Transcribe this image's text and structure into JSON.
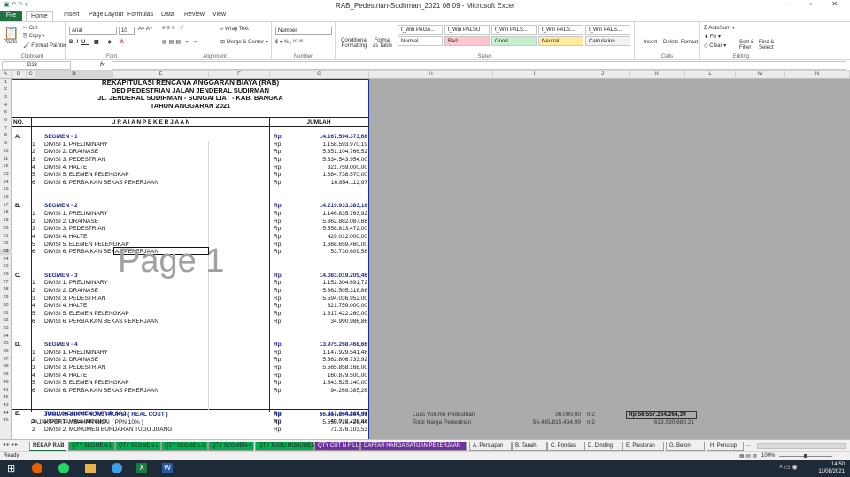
{
  "window": {
    "title": "RAB_Pedestrian-Sudirman_2021 08 09  -  Microsoft Excel",
    "controls": "— ▫ ✕"
  },
  "ribbon_tabs": [
    "File",
    "Home",
    "Insert",
    "Page Layout",
    "Formulas",
    "Data",
    "Review",
    "View"
  ],
  "ribbon": {
    "clipboard": {
      "paste": "Paste",
      "cut": "Cut",
      "copy": "Copy",
      "format_painter": "Format Painter",
      "label": "Clipboard"
    },
    "font": {
      "name": "Arial",
      "size": "10",
      "label": "Font"
    },
    "alignment": {
      "wrap": "Wrap Text",
      "merge": "Merge & Center",
      "label": "Alignment"
    },
    "number": {
      "format": "Number",
      "label": "Number"
    },
    "styles": {
      "cond": "Conditional Formatting",
      "table": "Format as Table",
      "label": "Styles",
      "items": [
        {
          "t": "t_Win PAGA...",
          "bg": "#ffffff"
        },
        {
          "t": "t_Win PALSU",
          "bg": "#ffffff"
        },
        {
          "t": "t_Win PALS...",
          "bg": "#ffffff"
        },
        {
          "t": "t_Win PALS...",
          "bg": "#ffffff"
        },
        {
          "t": "t_Win PALS...",
          "bg": "#ffffff"
        },
        {
          "t": "Normal",
          "bg": "#ffffff"
        },
        {
          "t": "Bad",
          "bg": "#ffc7ce"
        },
        {
          "t": "Good",
          "bg": "#c6efce"
        },
        {
          "t": "Neutral",
          "bg": "#ffeb9c"
        },
        {
          "t": "Calculation",
          "bg": "#f2f2f2"
        }
      ]
    },
    "cells": {
      "insert": "Insert",
      "delete": "Delete",
      "format": "Format",
      "label": "Cells"
    },
    "editing": {
      "autosum": "AutoSum",
      "fill": "Fill",
      "clear": "Clear",
      "sort": "Sort & Filter",
      "find": "Find & Select",
      "label": "Editing"
    }
  },
  "name_box": "D23",
  "fx": "fx",
  "columns": [
    "A",
    "B",
    "C",
    "D",
    "E",
    "F",
    "G",
    "H",
    "I",
    "J",
    "K",
    "L",
    "M",
    "N"
  ],
  "rows": [
    "1",
    "2",
    "3",
    "4",
    "5",
    "6",
    "7",
    "8",
    "9",
    "10",
    "11",
    "12",
    "13",
    "14",
    "15",
    "16",
    "17",
    "18",
    "19",
    "20",
    "21",
    "22",
    "23",
    "24",
    "25",
    "26",
    "27",
    "28",
    "29",
    "30",
    "31",
    "32",
    "33",
    "34",
    "35",
    "36",
    "37",
    "38",
    "39",
    "40",
    "41",
    "42",
    "43",
    "44",
    "45"
  ],
  "header": {
    "title": "REKAPITULASI RENCANA ANGGARAN BIAYA (RAB)",
    "line2": "DED PEDESTRIAN JALAN JENDERAL SUDIRMAN",
    "line3": "JL. JENDERAL SUDIRMAN - SUNGAI LIAT - KAB. BANGKA",
    "line4": "TAHUN ANGGARAN 2021"
  },
  "table_headers": {
    "no": "NO.",
    "uraian": "U R A I A N   P E K E R J A A N",
    "jumlah": "JUMLAH"
  },
  "sections": [
    {
      "no": "A.",
      "title": "SEGMEN - 1",
      "rp": "Rp",
      "total": "14.167.594.373,68",
      "items": [
        [
          "1",
          "DIVISI 1. PRELIMINARY",
          "1.158.593.970,19"
        ],
        [
          "2",
          "DIVISI 2. DRAINASE",
          "5.351.104.766,52"
        ],
        [
          "3",
          "DIVISI 3. PEDESTRIAN",
          "5.634.543.954,00"
        ],
        [
          "4",
          "DIVISI 4. HALTE",
          "321.759.000,00"
        ],
        [
          "5",
          "DIVISI 5. ELEMEN PELENGKAP",
          "1.684.738.570,00"
        ],
        [
          "6",
          "DIVISI 6. PERBAIKAN BEKAS PEKERJAAN",
          "16.854.112,97"
        ]
      ]
    },
    {
      "no": "B.",
      "title": "SEGMEN - 2",
      "rp": "Rp",
      "total": "14.219.933.383,18",
      "items": [
        [
          "1",
          "DIVISI 1. PRELIMINARY",
          "1.146.835.763,92"
        ],
        [
          "2",
          "DIVISI 2. DRAINASE",
          "5.362.882.087,68"
        ],
        [
          "3",
          "DIVISI 3. PEDESTRIAN",
          "5.558.813.472,00"
        ],
        [
          "4",
          "DIVISI 4. HALTE",
          "429.012.000,00"
        ],
        [
          "5",
          "DIVISI 5. ELEMEN PELENGKAP",
          "1.668.659.460,00"
        ],
        [
          "6",
          "DIVISI 6. PERBAIKAN BEKAS PEKERJAAN",
          "53.730.609,58"
        ]
      ]
    },
    {
      "no": "C.",
      "title": "SEGMEN - 3",
      "rp": "Rp",
      "total": "14.083.019.209,46",
      "items": [
        [
          "1",
          "DIVISI 1. PRELIMINARY",
          "1.152.304.691,72"
        ],
        [
          "2",
          "DIVISI 2. DRAINASE",
          "5.362.505.318,88"
        ],
        [
          "3",
          "DIVISI 3. PEDESTRIAN",
          "5.594.036.952,00"
        ],
        [
          "4",
          "DIVISI 4. HALTE",
          "321.759.000,00"
        ],
        [
          "5",
          "DIVISI 5. ELEMEN PELENGKAP",
          "1.617.422.260,00"
        ],
        [
          "6",
          "DIVISI 6. PERBAIKAN BEKAS PEKERJAAN",
          "34.990.986,86"
        ]
      ]
    },
    {
      "no": "D.",
      "title": "SEGMEN - 4",
      "rp": "Rp",
      "total": "13.975.268.468,66",
      "items": [
        [
          "1",
          "DIVISI 1. PRELIMINARY",
          "1.147.929.541,48"
        ],
        [
          "2",
          "DIVISI 2. DRAINASE",
          "5.362.806.733,92"
        ],
        [
          "3",
          "DIVISI 3. PEDESTRIAN",
          "5.565.858.168,00"
        ],
        [
          "4",
          "DIVISI 4. HALTE",
          "160.879.500,00"
        ],
        [
          "5",
          "DIVISI 5. ELEMEN PELENGKAP",
          "1.643.525.140,00"
        ],
        [
          "6",
          "DIVISI 6. PERBAIKAN BEKAS PEKERJAAN",
          "94.269.385,26"
        ]
      ]
    },
    {
      "no": "E.",
      "title": "TUGU MONUMEN TUTUP SAJI",
      "rp": "Rp",
      "total": "111.448.829,41",
      "items": [
        [
          "1",
          "DIVISI 1. PRELIMINARY",
          "40.072.725,88"
        ],
        [
          "2",
          "DIVISI 2. MONUMEN BUNDARAN TUGU JUANG",
          "71.376.103,53"
        ]
      ]
    }
  ],
  "total_row": {
    "label": "JUMLAH BIAYA KONSTRUKSI ( REAL COST )",
    "rp": "Rp",
    "value": "56.557.264.264,39"
  },
  "row45": {
    "label": "PAJAK PERTAMBAHAN NILAI ( PPN 10% )",
    "rp": "Rp",
    "value": "5.655.726.426,44"
  },
  "right_cells": {
    "luas_label": "Luas Volume Pedestrian",
    "luas_value": "36.000,00",
    "luas_unit": "m2",
    "rp_box": "Rp 56.557.264.264,39",
    "harga_label": "Total Harga Pedestrian",
    "harga_value": "56.445.815.434,99",
    "harga_unit": "m2",
    "harga_right": "619.990.689,21"
  },
  "watermark": "Page 1",
  "sheet_tabs": [
    {
      "t": "REKAP RAB",
      "c": "#ffffff"
    },
    {
      "t": "QTY SEGMEN-1",
      "c": "#00b050"
    },
    {
      "t": "QTY SEGMEN-2",
      "c": "#00b050"
    },
    {
      "t": "QTY SEGMEN-3",
      "c": "#00b050"
    },
    {
      "t": "QTY SEGMEN-4",
      "c": "#00b050"
    },
    {
      "t": "QTY TUGU MONUMEN",
      "c": "#00b050"
    },
    {
      "t": "QTY CUT N FILL",
      "c": "#7030a0"
    },
    {
      "t": "DAFTAR HARGA SATUAN PEKERJAAN",
      "c": "#7030a0"
    },
    {
      "t": "A. Persiapan",
      "c": "#f0f0f0"
    },
    {
      "t": "B. Tanah",
      "c": "#f0f0f0"
    },
    {
      "t": "C. Pondasi",
      "c": "#f0f0f0"
    },
    {
      "t": "D. Dinding",
      "c": "#f0f0f0"
    },
    {
      "t": "E. Plesteran",
      "c": "#f0f0f0"
    },
    {
      "t": "G. Beton",
      "c": "#f0f0f0"
    },
    {
      "t": "H. Penutup",
      "c": "#f0f0f0"
    }
  ],
  "status": {
    "left": "Ready",
    "zoom": "100%"
  },
  "clock": {
    "time": "14:50",
    "date": "11/08/2021"
  }
}
